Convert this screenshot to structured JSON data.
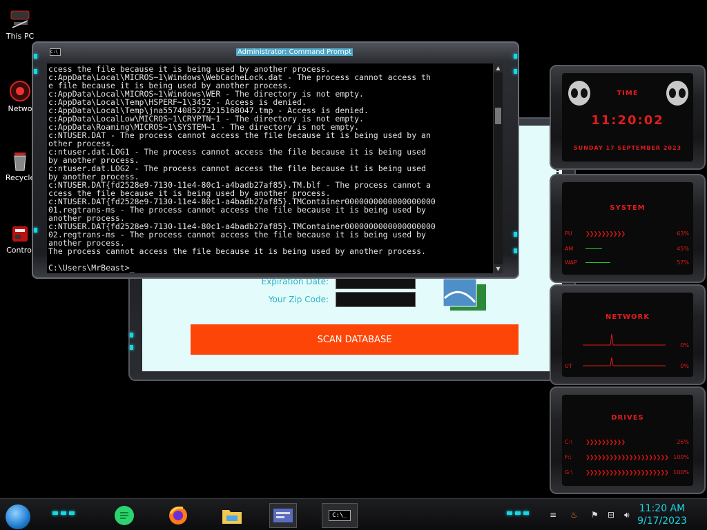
{
  "desktop_icons": [
    {
      "label": "This PC"
    },
    {
      "label": "Netwo"
    },
    {
      "label": "Recycle"
    },
    {
      "label": "Control"
    }
  ],
  "scan_dialog": {
    "expiration_label": "Expiration Date:",
    "zip_label": "Your Zip Code:",
    "button_label": "SCAN DATABASE",
    "question_fragment": "?"
  },
  "cmd": {
    "title": "Administrator: Command Prompt",
    "icon_text": "C:\\",
    "lines": [
      "ccess the file because it is being used by another process.",
      "c:AppData\\Local\\MICROS~1\\Windows\\WebCacheLock.dat - The process cannot access th",
      "e file because it is being used by another process.",
      "c:AppData\\Local\\MICROS~1\\Windows\\WER - The directory is not empty.",
      "c:AppData\\Local\\Temp\\HSPERF~1\\3452 - Access is denied.",
      "c:AppData\\Local\\Temp\\jna5574085273215168047.tmp - Access is denied.",
      "c:AppData\\LocalLow\\MICROS~1\\CRYPTN~1 - The directory is not empty.",
      "c:AppData\\Roaming\\MICROS~1\\SYSTEM~1 - The directory is not empty.",
      "c:NTUSER.DAT - The process cannot access the file because it is being used by an",
      "other process.",
      "c:ntuser.dat.LOG1 - The process cannot access the file because it is being used",
      "by another process.",
      "c:ntuser.dat.LOG2 - The process cannot access the file because it is being used",
      "by another process.",
      "c:NTUSER.DAT{fd2528e9-7130-11e4-80c1-a4badb27af85}.TM.blf - The process cannot a",
      "ccess the file because it is being used by another process.",
      "c:NTUSER.DAT{fd2528e9-7130-11e4-80c1-a4badb27af85}.TMContainer0000000000000000000",
      "01.regtrans-ms - The process cannot access the file because it is being used by",
      "another process.",
      "c:NTUSER.DAT{fd2528e9-7130-11e4-80c1-a4badb27af85}.TMContainer0000000000000000000",
      "02.regtrans-ms - The process cannot access the file because it is being used by",
      "another process.",
      "The process cannot access the file because it is being used by another process.",
      "",
      "C:\\Users\\MrBeast>_"
    ]
  },
  "widgets": {
    "time": {
      "title": "TIME",
      "clock": "11:20:02",
      "date": "SUNDAY 17 SEPTEMBER 2023"
    },
    "system": {
      "title": "SYSTEM",
      "rows": [
        {
          "name": "PU",
          "value": "63%"
        },
        {
          "name": "AM",
          "value": "45%"
        },
        {
          "name": "WAP",
          "value": "57%"
        }
      ]
    },
    "network": {
      "title": "NETWORK",
      "rows": [
        {
          "name": "",
          "value": "0%"
        },
        {
          "name": "UT",
          "value": "0%"
        }
      ]
    },
    "drives": {
      "title": "DRIVES",
      "rows": [
        {
          "name": "C:\\",
          "value": "26%"
        },
        {
          "name": "F:\\",
          "value": "100%"
        },
        {
          "name": "G:\\",
          "value": "100%"
        }
      ]
    }
  },
  "taskbar": {
    "clock_time": "11:20 AM",
    "clock_date": "9/17/2023",
    "apps": [
      "chat-icon",
      "firefox-icon",
      "file-explorer-icon",
      "control-panel-icon",
      "command-prompt-icon"
    ],
    "cmd_icon_text": "C:\\_"
  },
  "colors": {
    "accent_cyan": "#19d6e3",
    "alert_red": "#e31b1b",
    "scan_button": "#fd4507",
    "dialog_bg": "#e3fbfb"
  }
}
